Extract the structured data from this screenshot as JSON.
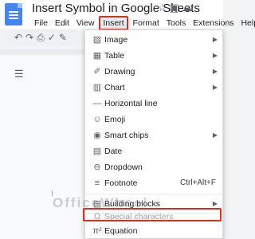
{
  "app": {
    "title": "Insert Symbol in Google Sheets",
    "menubar": [
      "File",
      "Edit",
      "View",
      "Insert",
      "Format",
      "Tools",
      "Extensions",
      "Help"
    ]
  },
  "menu": {
    "items": [
      {
        "label": "Image",
        "icon": "image-icon",
        "submenu": true
      },
      {
        "label": "Table",
        "icon": "table-icon",
        "submenu": true
      },
      {
        "label": "Drawing",
        "icon": "drawing-icon",
        "submenu": true
      },
      {
        "label": "Chart",
        "icon": "chart-icon",
        "submenu": true
      },
      {
        "label": "Horizontal line",
        "icon": "horizontal-line-icon",
        "submenu": false
      },
      {
        "label": "Emoji",
        "icon": "emoji-icon",
        "submenu": false
      },
      {
        "label": "Smart chips",
        "icon": "smart-chips-icon",
        "submenu": true
      },
      {
        "label": "Date",
        "icon": "date-icon",
        "submenu": false
      },
      {
        "label": "Dropdown",
        "icon": "dropdown-icon",
        "submenu": false
      },
      {
        "label": "Footnote",
        "icon": "footnote-icon",
        "shortcut": "Ctrl+Alt+F"
      },
      {
        "label": "Building blocks",
        "icon": "building-blocks-icon",
        "submenu": true
      },
      {
        "label": "Special characters",
        "icon": "omega-icon",
        "submenu": false
      },
      {
        "label": "Equation",
        "icon": "pi-icon",
        "submenu": false
      }
    ]
  },
  "watermark": "OfficeWheel",
  "colors": {
    "accent": "#d93025",
    "doc_blue": "#4285f4"
  }
}
